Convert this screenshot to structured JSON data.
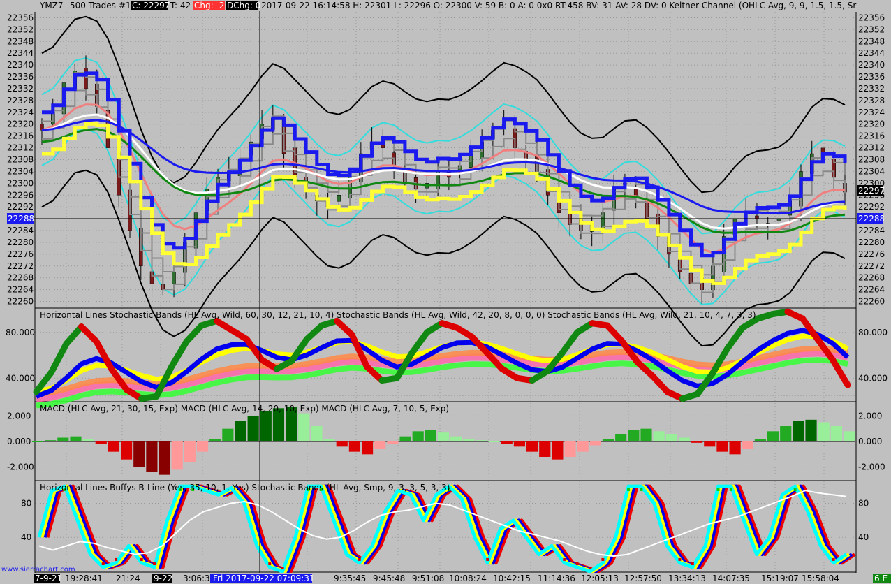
{
  "colors": {
    "background": "#c0c0c0",
    "grid": "#9a9a9a",
    "text": "#000000",
    "candle_up": "#2f6f2f",
    "candle_down": "#7a1a1a",
    "keltner_outer": "#000000",
    "keltner_inner": "#33dddd",
    "ma_blue": "#1a1aee",
    "ma_white": "#ffffff",
    "ma_salmon": "#f08080",
    "ma_green": "#118811",
    "ma_yellow": "#ffff33",
    "stair_gray": "#888888",
    "stoch_green": "#118811",
    "stoch_red": "#dd0000",
    "stoch_yellow": "#ffff00",
    "stoch_blue": "#0000ee",
    "stoch_pink": "#ff66aa",
    "stoch_magenta": "#ff1177",
    "stoch_orange": "#ff8844",
    "stoch_lime": "#33ff33",
    "macd_lightgreen": "#99ee99",
    "macd_green": "#22aa22",
    "macd_darkgreen": "#006600",
    "macd_pink": "#ff9999",
    "macd_red": "#dd0000",
    "macd_darkred": "#880000",
    "buffy_cyan": "#00ffff",
    "buffy_red": "#ee0000",
    "buffy_dots_red": "#dd0000",
    "buffy_dots_green": "#11cc11",
    "price_tag_blue": "#1a1aee",
    "price_tag_black": "#000000",
    "chg_red": "#ff3333",
    "time_tag_blue": "#1a1aee"
  },
  "header": {
    "symbol": "YMZ7",
    "bars": "500 Trades",
    "chart_no": "#1",
    "close_label": "C: 22297",
    "t_label": "T: 42",
    "chg_label": "Chg: -2",
    "dchg_label": "DChg: 0",
    "info": "2017-09-22 16:14:58 H: 22301 L: 22296 O: 22300 V: 59 B: 0 A: 0 0x0 RT:458 BV: 31 AV: 28 DV: 0  Keltner Channel   (OHLC Avg, 9, 9, 1.5, 1.5, Sr"
  },
  "panes": {
    "stoch_title": "Horizontal Lines  Stochastic Bands   (HL Avg, Wild, 60, 30, 12, 21, 10, 4)  Stochastic Bands   (HL Avg, Wild, 42, 20, 8, 0, 0, 0)  Stochastic Bands   (HL Avg, Wild, 21, 10, 4, 7, 3, 3)",
    "macd_title": "MACD   (HLC Avg, 21, 30, 15, Exp)  MACD   (HLC Avg, 14, 20, 10, Exp)  MACD   (HLC Avg, 7, 10, 5, Exp)",
    "buffy_title": "Horizontal Lines  Buffys B-Line   (Yes, 35, 10, 1, Yes) Stochastic Bands   (HL Avg, Smp, 9, 3, 3, 5, 3, 3)"
  },
  "price_axis": {
    "ticks": [
      "22356",
      "22352",
      "22348",
      "22344",
      "22340",
      "22336",
      "22332",
      "22328",
      "22324",
      "22320",
      "22316",
      "22312",
      "22308",
      "22304",
      "22300",
      "22296",
      "22292",
      "22288",
      "22284",
      "22280",
      "22276",
      "22272",
      "22268",
      "22264",
      "22260"
    ],
    "current_price_tag": "22297",
    "crosshair_price_tag": "22288"
  },
  "stoch_axis": {
    "ticks": [
      "80.000",
      "40.000"
    ]
  },
  "macd_axis": {
    "ticks": [
      "2.000",
      "0.000",
      "-2.000"
    ]
  },
  "buffy_axis": {
    "ticks": [
      "80",
      "40"
    ]
  },
  "time_axis": {
    "start_tag": "7-9-21",
    "labels": [
      "19:28:41",
      "21:24",
      "9-22",
      "3:06:3",
      "9:35:45",
      "9:45:48",
      "9:51:08",
      "10:08:24",
      "10:42:15",
      "11:14:36",
      "12:05:13",
      "12:57:50",
      "13:34:13",
      "14:07:35",
      "15:19:07",
      "15:58:04"
    ],
    "crosshair_time_tag": "Fri 2017-09-22  07:09:31",
    "end_tag": "6 E"
  },
  "watermark": "www.sierrachart.com",
  "chart_data": [
    {
      "type": "candlestick",
      "title": "YMZ7 500 Trades #1 — Keltner Channel",
      "ylim": [
        22258,
        22358
      ],
      "close_series": [
        22318,
        22324,
        22334,
        22338,
        22332,
        22326,
        22312,
        22296,
        22284,
        22272,
        22266,
        22264,
        22270,
        22280,
        22290,
        22298,
        22302,
        22304,
        22308,
        22314,
        22320,
        22322,
        22310,
        22302,
        22298,
        22294,
        22292,
        22296,
        22302,
        22310,
        22314,
        22312,
        22306,
        22300,
        22298,
        22300,
        22304,
        22302,
        22306,
        22310,
        22314,
        22318,
        22320,
        22312,
        22308,
        22304,
        22296,
        22290,
        22286,
        22284,
        22286,
        22290,
        22298,
        22300,
        22296,
        22288,
        22282,
        22276,
        22270,
        22266,
        22264,
        22272,
        22282,
        22288,
        22290,
        22288,
        22286,
        22288,
        22294,
        22304,
        22310,
        22308,
        22302,
        22297
      ]
    },
    {
      "type": "line",
      "title": "Stochastic Bands",
      "ylim": [
        20,
        100
      ],
      "series": [
        {
          "values": [
            28,
            45,
            70,
            85,
            72,
            48,
            30,
            22,
            24,
            50,
            72,
            86,
            90,
            82,
            74,
            56,
            48,
            55,
            74,
            86,
            90,
            78,
            50,
            38,
            40,
            62,
            80,
            88,
            84,
            76,
            62,
            48,
            40,
            38,
            46,
            62,
            80,
            88,
            86,
            72,
            54,
            42,
            28,
            22,
            26,
            44,
            66,
            84,
            92,
            96,
            98,
            92,
            74,
            56,
            34
          ]
        }
      ]
    },
    {
      "type": "bar",
      "title": "MACD",
      "ylim": [
        -3,
        3
      ],
      "series": [
        {
          "values": [
            0,
            0.1,
            0.3,
            0.4,
            0.2,
            -0.2,
            -0.8,
            -1.4,
            -2.0,
            -2.4,
            -2.6,
            -2.2,
            -1.6,
            -0.8,
            0.2,
            1.0,
            1.6,
            2.0,
            2.4,
            2.6,
            2.7,
            2.2,
            1.2,
            0.2,
            -0.4,
            -0.8,
            -1.0,
            -0.6,
            -0.2,
            0.4,
            0.8,
            0.9,
            0.7,
            0.4,
            0.2,
            0.1,
            0.0,
            -0.2,
            -0.4,
            -0.8,
            -1.2,
            -1.4,
            -1.2,
            -0.8,
            -0.3,
            0.2,
            0.6,
            0.9,
            1.0,
            0.8,
            0.6,
            0.3,
            -0.1,
            -0.4,
            -0.8,
            -1.0,
            -0.6,
            0.2,
            0.8,
            1.2,
            1.6,
            1.7,
            1.5,
            1.2,
            0.8
          ]
        }
      ]
    },
    {
      "type": "line",
      "title": "Buffys B-Line / Stochastic Bands",
      "ylim": [
        0,
        105
      ],
      "series": [
        {
          "values": [
            40,
            95,
            100,
            60,
            20,
            5,
            10,
            30,
            10,
            5,
            60,
            100,
            100,
            95,
            90,
            98,
            80,
            30,
            5,
            0,
            40,
            100,
            100,
            60,
            20,
            10,
            30,
            70,
            95,
            90,
            60,
            90,
            100,
            85,
            40,
            10,
            50,
            60,
            40,
            20,
            30,
            10,
            5,
            0,
            10,
            40,
            100,
            100,
            80,
            30,
            10,
            5,
            30,
            100,
            100,
            60,
            20,
            40,
            90,
            100,
            70,
            30,
            10,
            20
          ]
        },
        {
          "values": [
            30,
            25,
            30,
            35,
            33,
            28,
            24,
            20,
            22,
            30,
            45,
            60,
            70,
            75,
            80,
            82,
            78,
            70,
            60,
            50,
            42,
            38,
            40,
            48,
            58,
            66,
            70,
            72,
            76,
            80,
            78,
            72,
            66,
            60,
            54,
            48,
            44,
            40,
            36,
            30,
            24,
            20,
            18,
            20,
            26,
            32,
            38,
            44,
            50,
            56,
            60,
            64,
            70,
            76,
            82,
            88,
            95,
            92,
            90,
            88
          ]
        }
      ]
    }
  ]
}
